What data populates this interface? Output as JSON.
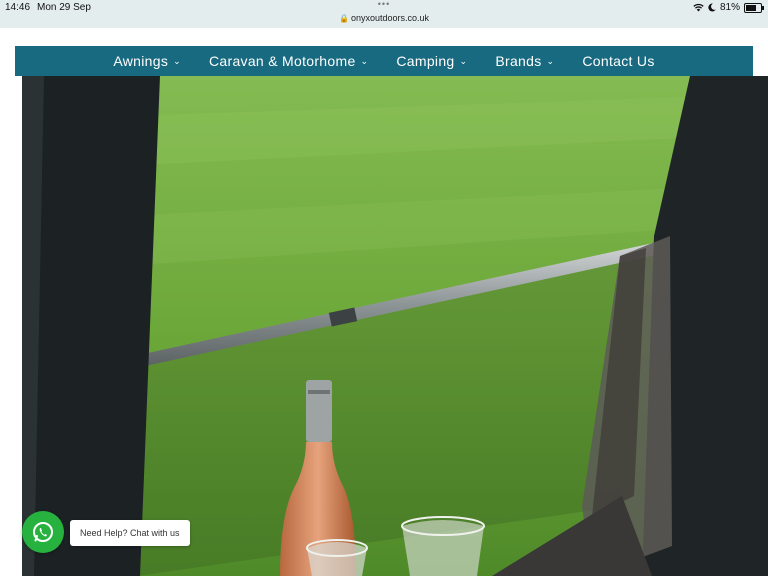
{
  "status_bar": {
    "time": "14:46",
    "date": "Mon 29 Sep",
    "url": "onyxoutdoors.co.uk",
    "battery": "81%",
    "icons": [
      "wifi-icon",
      "moon-icon",
      "battery-icon",
      "lock-icon"
    ]
  },
  "nav": {
    "items": [
      {
        "label": "Awnings",
        "has_dropdown": true
      },
      {
        "label": "Caravan & Motorhome",
        "has_dropdown": true
      },
      {
        "label": "Camping",
        "has_dropdown": true
      },
      {
        "label": "Brands",
        "has_dropdown": true
      },
      {
        "label": "Contact Us",
        "has_dropdown": false
      }
    ],
    "background": "#176a80"
  },
  "chat_widget": {
    "label": "Need Help? Chat with us",
    "icon": "whatsapp-icon",
    "color": "#27b240"
  }
}
